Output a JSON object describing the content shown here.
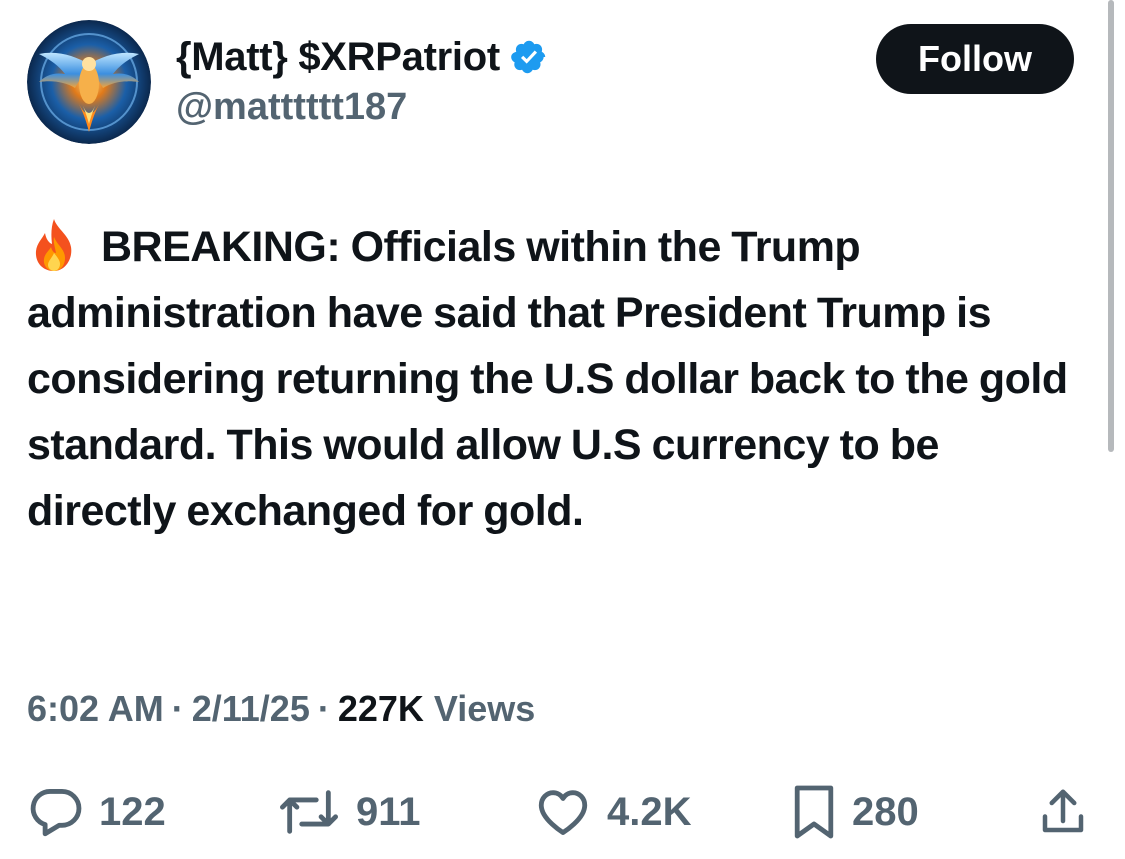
{
  "author": {
    "display_name": "{Matt} $XRPatriot",
    "handle": "@matttttt187",
    "verified": true
  },
  "follow_button": {
    "label": "Follow"
  },
  "tweet": {
    "emoji": "fire-icon",
    "text": "BREAKING: Officials within the Trump administration have said that President Trump is considering returning the U.S dollar back to the gold standard. This would allow U.S currency to be directly exchanged for gold."
  },
  "meta": {
    "time": "6:02 AM",
    "date": "2/11/25",
    "views_count": "227K",
    "views_label": "Views",
    "separator": "·"
  },
  "actions": {
    "replies": "122",
    "reposts": "911",
    "likes": "4.2K",
    "bookmarks": "280"
  },
  "colors": {
    "text_primary": "#0f1419",
    "text_secondary": "#536471",
    "verified_blue": "#1d9bf0",
    "button_bg": "#0f1419"
  }
}
